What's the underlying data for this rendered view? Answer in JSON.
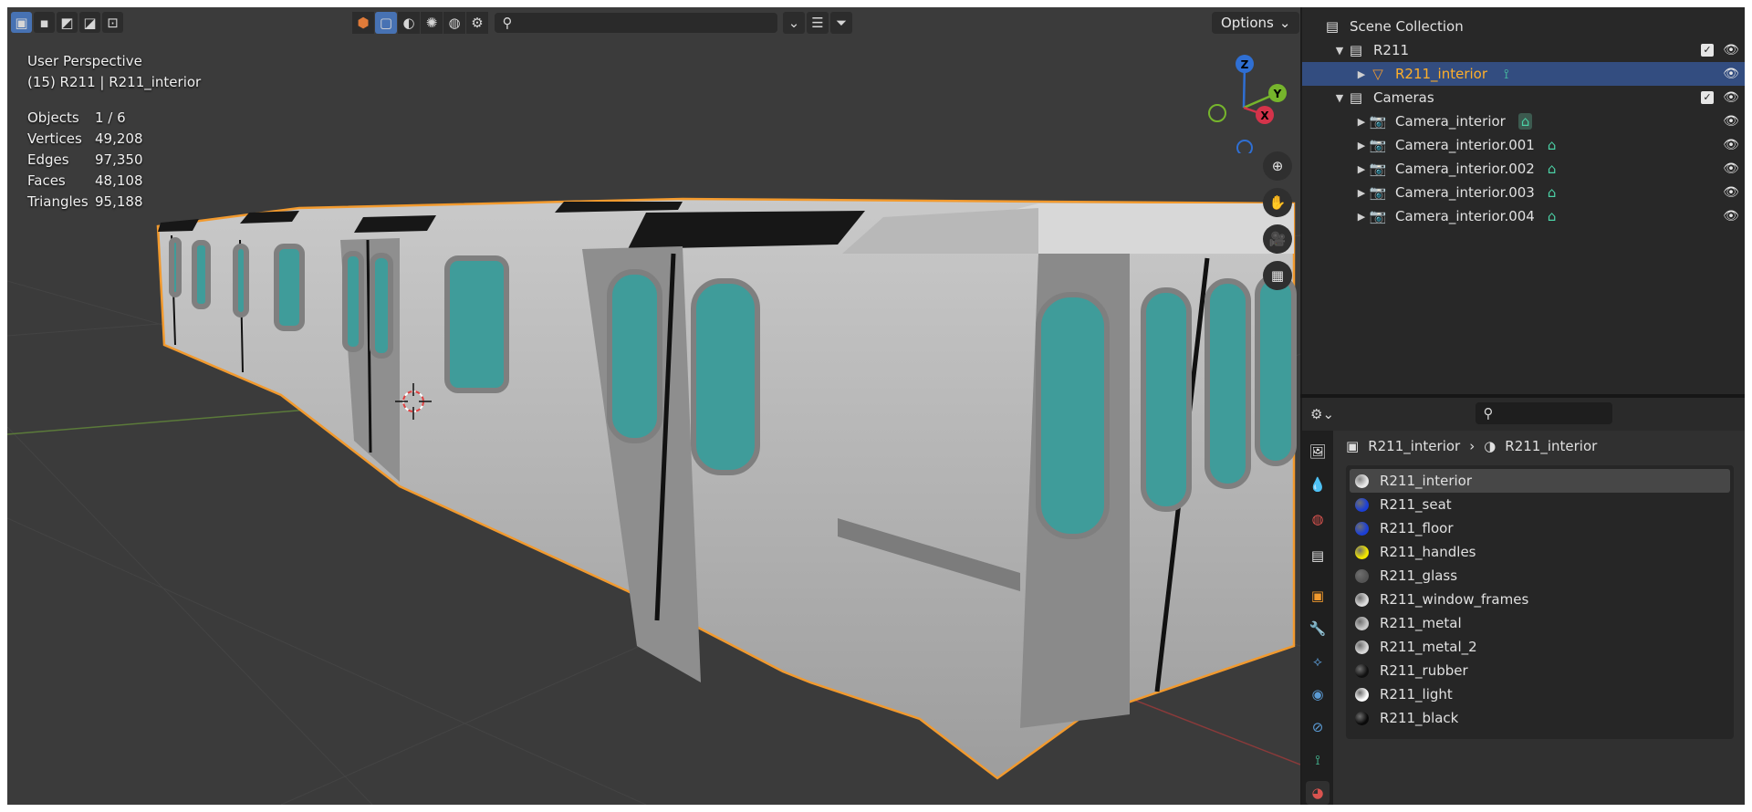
{
  "viewport": {
    "options_label": "Options",
    "view_name": "User Perspective",
    "object_info": "(15) R211 | R211_interior",
    "stats": [
      {
        "label": "Objects",
        "value": "1 / 6"
      },
      {
        "label": "Vertices",
        "value": "49,208"
      },
      {
        "label": "Edges",
        "value": "97,350"
      },
      {
        "label": "Faces",
        "value": "48,108"
      },
      {
        "label": "Triangles",
        "value": "95,188"
      }
    ],
    "gizmo": {
      "z": "Z",
      "y": "Y",
      "x": "X"
    }
  },
  "outliner": {
    "title": "Scene Collection",
    "rows": [
      {
        "label": "R211"
      },
      {
        "label": "R211_interior"
      },
      {
        "label": "Cameras"
      },
      {
        "label": "Camera_interior"
      },
      {
        "label": "Camera_interior.001"
      },
      {
        "label": "Camera_interior.002"
      },
      {
        "label": "Camera_interior.003"
      },
      {
        "label": "Camera_interior.004"
      }
    ]
  },
  "properties": {
    "object_name": "R211_interior",
    "material_name": "R211_interior",
    "materials": [
      {
        "name": "R211_interior",
        "color": "#e8e8e8"
      },
      {
        "name": "R211_seat",
        "color": "#1b3fd6"
      },
      {
        "name": "R211_floor",
        "color": "#1b3fd6"
      },
      {
        "name": "R211_handles",
        "color": "#f2e600"
      },
      {
        "name": "R211_glass",
        "color": "#555555"
      },
      {
        "name": "R211_window_frames",
        "color": "#dcdcdc"
      },
      {
        "name": "R211_metal",
        "color": "#c8c8c8"
      },
      {
        "name": "R211_metal_2",
        "color": "#d8d8d8"
      },
      {
        "name": "R211_rubber",
        "color": "#111111"
      },
      {
        "name": "R211_light",
        "color": "#ffffff"
      },
      {
        "name": "R211_black",
        "color": "#0a0a0a"
      }
    ]
  }
}
